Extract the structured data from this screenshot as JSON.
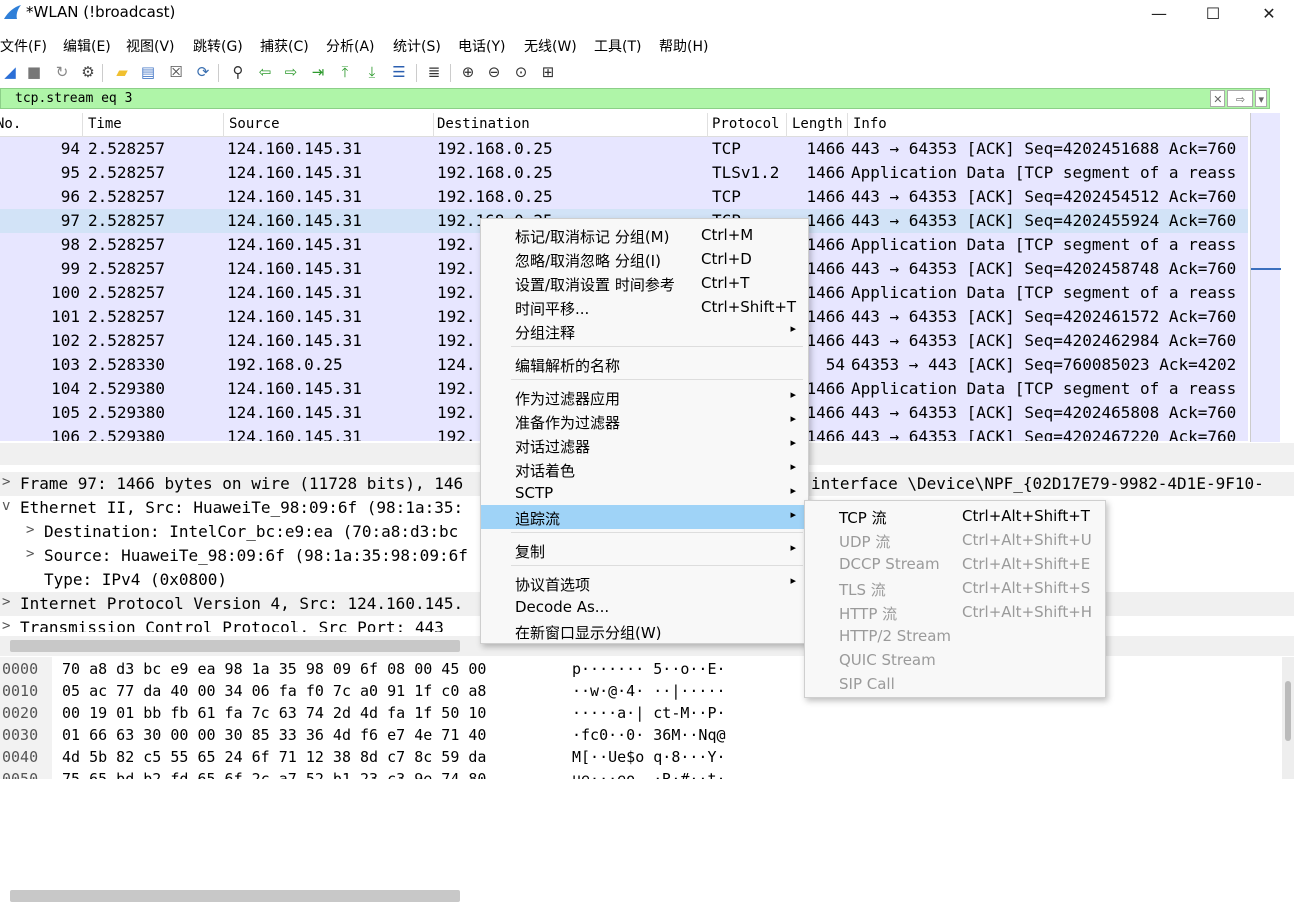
{
  "window": {
    "title": "*WLAN (!broadcast)",
    "minimize_glyph": "—",
    "maximize_glyph": "☐",
    "close_glyph": "✕"
  },
  "menubar": [
    "文件(F)",
    "编辑(E)",
    "视图(V)",
    "跳转(G)",
    "捕获(C)",
    "分析(A)",
    "统计(S)",
    "电话(Y)",
    "无线(W)",
    "工具(T)",
    "帮助(H)"
  ],
  "toolbar_icons": [
    {
      "name": "shark-fin-start-icon",
      "glyph": "◢",
      "color": "#2b6fd6"
    },
    {
      "name": "stop-capture-icon",
      "glyph": "■",
      "color": "#777777"
    },
    {
      "name": "restart-capture-icon",
      "glyph": "↻",
      "color": "#888888"
    },
    {
      "name": "capture-options-icon",
      "glyph": "⚙",
      "color": "#444444"
    },
    {
      "name": "open-file-icon",
      "glyph": "▰",
      "color": "#f0c030"
    },
    {
      "name": "save-file-icon",
      "glyph": "▤",
      "color": "#4a7bc8"
    },
    {
      "name": "close-file-icon",
      "glyph": "☒",
      "color": "#555555"
    },
    {
      "name": "reload-file-icon",
      "glyph": "⟳",
      "color": "#3a6fb0"
    },
    {
      "name": "find-packet-icon",
      "glyph": "⚲",
      "color": "#333333"
    },
    {
      "name": "go-back-icon",
      "glyph": "⇦",
      "color": "#2e9a2e"
    },
    {
      "name": "go-forward-icon",
      "glyph": "⇨",
      "color": "#2e9a2e"
    },
    {
      "name": "go-to-packet-icon",
      "glyph": "⇥",
      "color": "#2e9a2e"
    },
    {
      "name": "first-packet-icon",
      "glyph": "⤒",
      "color": "#2e9a2e"
    },
    {
      "name": "last-packet-icon",
      "glyph": "⤓",
      "color": "#2e9a2e"
    },
    {
      "name": "autoscroll-icon",
      "glyph": "☰",
      "color": "#2b5fb0"
    },
    {
      "name": "colorize-icon",
      "glyph": "≣",
      "color": "#333333"
    },
    {
      "name": "zoom-in-icon",
      "glyph": "⊕",
      "color": "#333333"
    },
    {
      "name": "zoom-out-icon",
      "glyph": "⊖",
      "color": "#333333"
    },
    {
      "name": "zoom-normal-icon",
      "glyph": "⊙",
      "color": "#333333"
    },
    {
      "name": "resize-columns-icon",
      "glyph": "⊞",
      "color": "#333333"
    }
  ],
  "filter": {
    "value": "tcp.stream eq 3",
    "clear_glyph": "✕",
    "apply_glyph": "⇨",
    "dropdown_glyph": "▾"
  },
  "packet_list": {
    "columns": [
      "No.",
      "Time",
      "Source",
      "Destination",
      "Protocol",
      "Length",
      "Info"
    ],
    "rows": [
      {
        "no": "94",
        "time": "2.528257",
        "src": "124.160.145.31",
        "dst": "192.168.0.25",
        "proto": "TCP",
        "len": "1466",
        "info": "443 → 64353 [ACK] Seq=4202451688 Ack=760"
      },
      {
        "no": "95",
        "time": "2.528257",
        "src": "124.160.145.31",
        "dst": "192.168.0.25",
        "proto": "TLSv1.2",
        "len": "1466",
        "info": "Application Data [TCP segment of a reass"
      },
      {
        "no": "96",
        "time": "2.528257",
        "src": "124.160.145.31",
        "dst": "192.168.0.25",
        "proto": "TCP",
        "len": "1466",
        "info": "443 → 64353 [ACK] Seq=4202454512 Ack=760"
      },
      {
        "no": "97",
        "time": "2.528257",
        "src": "124.160.145.31",
        "dst": "192.168.0.25",
        "proto": "TCP",
        "len": "1466",
        "info": "443 → 64353 [ACK] Seq=4202455924 Ack=760",
        "selected": true
      },
      {
        "no": "98",
        "time": "2.528257",
        "src": "124.160.145.31",
        "dst": "192.",
        "proto": "",
        "len": "1466",
        "info": "Application Data [TCP segment of a reass"
      },
      {
        "no": "99",
        "time": "2.528257",
        "src": "124.160.145.31",
        "dst": "192.",
        "proto": "",
        "len": "1466",
        "info": "443 → 64353 [ACK] Seq=4202458748 Ack=760"
      },
      {
        "no": "100",
        "time": "2.528257",
        "src": "124.160.145.31",
        "dst": "192.",
        "proto": "",
        "len": "1466",
        "info": "Application Data [TCP segment of a reass"
      },
      {
        "no": "101",
        "time": "2.528257",
        "src": "124.160.145.31",
        "dst": "192.",
        "proto": "",
        "len": "1466",
        "info": "443 → 64353 [ACK] Seq=4202461572 Ack=760"
      },
      {
        "no": "102",
        "time": "2.528257",
        "src": "124.160.145.31",
        "dst": "192.",
        "proto": "",
        "len": "1466",
        "info": "443 → 64353 [ACK] Seq=4202462984 Ack=760"
      },
      {
        "no": "103",
        "time": "2.528330",
        "src": "192.168.0.25",
        "dst": "124.",
        "proto": "",
        "len": "54",
        "info": "64353 → 443 [ACK] Seq=760085023 Ack=4202"
      },
      {
        "no": "104",
        "time": "2.529380",
        "src": "124.160.145.31",
        "dst": "192.",
        "proto": "",
        "len": "1466",
        "info": "Application Data [TCP segment of a reass"
      },
      {
        "no": "105",
        "time": "2.529380",
        "src": "124.160.145.31",
        "dst": "192.",
        "proto": "",
        "len": "1466",
        "info": "443 → 64353 [ACK] Seq=4202465808 Ack=760"
      },
      {
        "no": "106",
        "time": "2.529380",
        "src": "124.160.145.31",
        "dst": "192.",
        "proto": "",
        "len": "1466",
        "info": "443 → 64353 [ACK] Seq=4202467220 Ack=760"
      }
    ]
  },
  "details": [
    {
      "expander": ">",
      "text": "Frame 97: 1466 bytes on wire (11728 bits), 146",
      "tail": "interface \\Device\\NPF_{02D17E79-9982-4D1E-9F10-"
    },
    {
      "expander": "v",
      "text": "Ethernet II, Src: HuaweiTe_98:09:6f (98:1a:35:",
      "tail": ""
    },
    {
      "expander": ">",
      "text": "Destination: IntelCor_bc:e9:ea (70:a8:d3:bc",
      "tail": ""
    },
    {
      "expander": ">",
      "text": "Source: HuaweiTe_98:09:6f (98:1a:35:98:09:6f",
      "tail": ""
    },
    {
      "expander": "",
      "text": "Type: IPv4 (0x0800)",
      "tail": ""
    },
    {
      "expander": ">",
      "text": "Internet Protocol Version 4, Src: 124.160.145.",
      "tail": ""
    },
    {
      "expander": ">",
      "text": "Transmission Control Protocol, Src Port: 443",
      "tail": ""
    }
  ],
  "hex": [
    {
      "off": "0000",
      "bytes": "70 a8 d3 bc e9 ea 98 1a  35 98 09 6f 08 00 45 00",
      "ascii": "p·······  5··o··E·"
    },
    {
      "off": "0010",
      "bytes": "05 ac 77 da 40 00 34 06  fa f0 7c a0 91 1f c0 a8",
      "ascii": "··w·@·4·  ··|·····"
    },
    {
      "off": "0020",
      "bytes": "00 19 01 bb fb 61 fa 7c  63 74 2d 4d fa 1f 50 10",
      "ascii": "·····a·|  ct-M··P·"
    },
    {
      "off": "0030",
      "bytes": "01 66 63 30 00 00 30 85  33 36 4d f6 e7 4e 71 40",
      "ascii": "·fc0··0·  36M··Nq@"
    },
    {
      "off": "0040",
      "bytes": "4d 5b 82 c5 55 65 24 6f  71 12 38 8d c7 8c 59 da",
      "ascii": "M[··Ue$o  q·8···Y·"
    },
    {
      "off": "0050",
      "bytes": "75 65 bd b2 fd 65 6f 2c  a7 52 b1 23 c3 9e 74 80",
      "ascii": "ue···eo,  ·R·#··t·"
    }
  ],
  "context_menu": {
    "items": [
      {
        "label": "标记/取消标记 分组(M)",
        "shortcut": "Ctrl+M"
      },
      {
        "label": "忽略/取消忽略 分组(I)",
        "shortcut": "Ctrl+D"
      },
      {
        "label": "设置/取消设置 时间参考",
        "shortcut": "Ctrl+T"
      },
      {
        "label": "时间平移...",
        "shortcut": "Ctrl+Shift+T"
      },
      {
        "label": "分组注释",
        "shortcut": "",
        "submenu": true
      },
      {
        "label": "编辑解析的名称",
        "shortcut": ""
      },
      {
        "label": "作为过滤器应用",
        "shortcut": "",
        "submenu": true
      },
      {
        "label": "准备作为过滤器",
        "shortcut": "",
        "submenu": true
      },
      {
        "label": "对话过滤器",
        "shortcut": "",
        "submenu": true
      },
      {
        "label": "对话着色",
        "shortcut": "",
        "submenu": true
      },
      {
        "label": "SCTP",
        "shortcut": "",
        "submenu": true
      },
      {
        "label": "追踪流",
        "shortcut": "",
        "submenu": true,
        "active": true
      },
      {
        "label": "复制",
        "shortcut": "",
        "submenu": true
      },
      {
        "label": "协议首选项",
        "shortcut": "",
        "submenu": true
      },
      {
        "label": "Decode As...",
        "shortcut": ""
      },
      {
        "label": "在新窗口显示分组(W)",
        "shortcut": ""
      }
    ],
    "submenu_glyph": "▸"
  },
  "follow_submenu": {
    "items": [
      {
        "label": "TCP 流",
        "shortcut": "Ctrl+Alt+Shift+T",
        "enabled": true
      },
      {
        "label": "UDP 流",
        "shortcut": "Ctrl+Alt+Shift+U",
        "enabled": false
      },
      {
        "label": "DCCP Stream",
        "shortcut": "Ctrl+Alt+Shift+E",
        "enabled": false
      },
      {
        "label": "TLS 流",
        "shortcut": "Ctrl+Alt+Shift+S",
        "enabled": false
      },
      {
        "label": "HTTP 流",
        "shortcut": "Ctrl+Alt+Shift+H",
        "enabled": false
      },
      {
        "label": "HTTP/2 Stream",
        "shortcut": "",
        "enabled": false
      },
      {
        "label": "QUIC Stream",
        "shortcut": "",
        "enabled": false
      },
      {
        "label": "SIP Call",
        "shortcut": "",
        "enabled": false
      }
    ]
  }
}
